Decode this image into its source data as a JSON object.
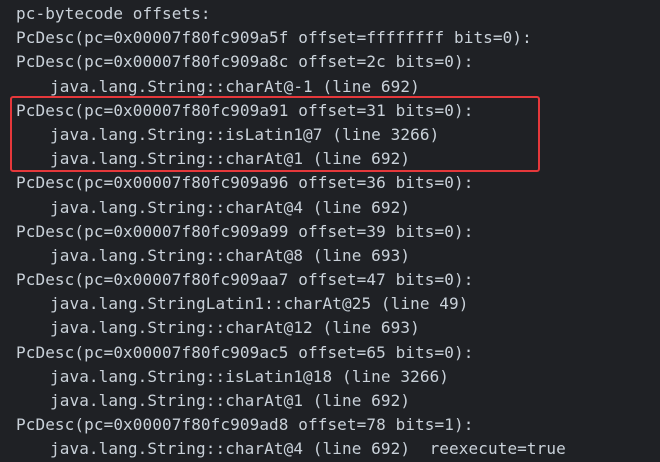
{
  "terminal": {
    "lines": [
      {
        "text": "pc-bytecode offsets:",
        "indent": 0
      },
      {
        "text": "PcDesc(pc=0x00007f80fc909a5f offset=ffffffff bits=0):",
        "indent": 0
      },
      {
        "text": "PcDesc(pc=0x00007f80fc909a8c offset=2c bits=0):",
        "indent": 0
      },
      {
        "text": "java.lang.String::charAt@-1 (line 692)",
        "indent": 1
      },
      {
        "text": "PcDesc(pc=0x00007f80fc909a91 offset=31 bits=0):",
        "indent": 0
      },
      {
        "text": "java.lang.String::isLatin1@7 (line 3266)",
        "indent": 1
      },
      {
        "text": "java.lang.String::charAt@1 (line 692)",
        "indent": 1
      },
      {
        "text": "PcDesc(pc=0x00007f80fc909a96 offset=36 bits=0):",
        "indent": 0
      },
      {
        "text": "java.lang.String::charAt@4 (line 692)",
        "indent": 1
      },
      {
        "text": "PcDesc(pc=0x00007f80fc909a99 offset=39 bits=0):",
        "indent": 0
      },
      {
        "text": "java.lang.String::charAt@8 (line 693)",
        "indent": 1
      },
      {
        "text": "PcDesc(pc=0x00007f80fc909aa7 offset=47 bits=0):",
        "indent": 0
      },
      {
        "text": "java.lang.StringLatin1::charAt@25 (line 49)",
        "indent": 1
      },
      {
        "text": "java.lang.String::charAt@12 (line 693)",
        "indent": 1
      },
      {
        "text": "PcDesc(pc=0x00007f80fc909ac5 offset=65 bits=0):",
        "indent": 0
      },
      {
        "text": "java.lang.String::isLatin1@18 (line 3266)",
        "indent": 1
      },
      {
        "text": "java.lang.String::charAt@1 (line 692)",
        "indent": 1
      },
      {
        "text": "PcDesc(pc=0x00007f80fc909ad8 offset=78 bits=1):",
        "indent": 0
      },
      {
        "text": "java.lang.String::charAt@4 (line 692)  reexecute=true",
        "indent": 1
      }
    ]
  },
  "colors": {
    "background": "#1f2125",
    "text": "#c9d1d9",
    "highlight_border": "#e5383b"
  }
}
